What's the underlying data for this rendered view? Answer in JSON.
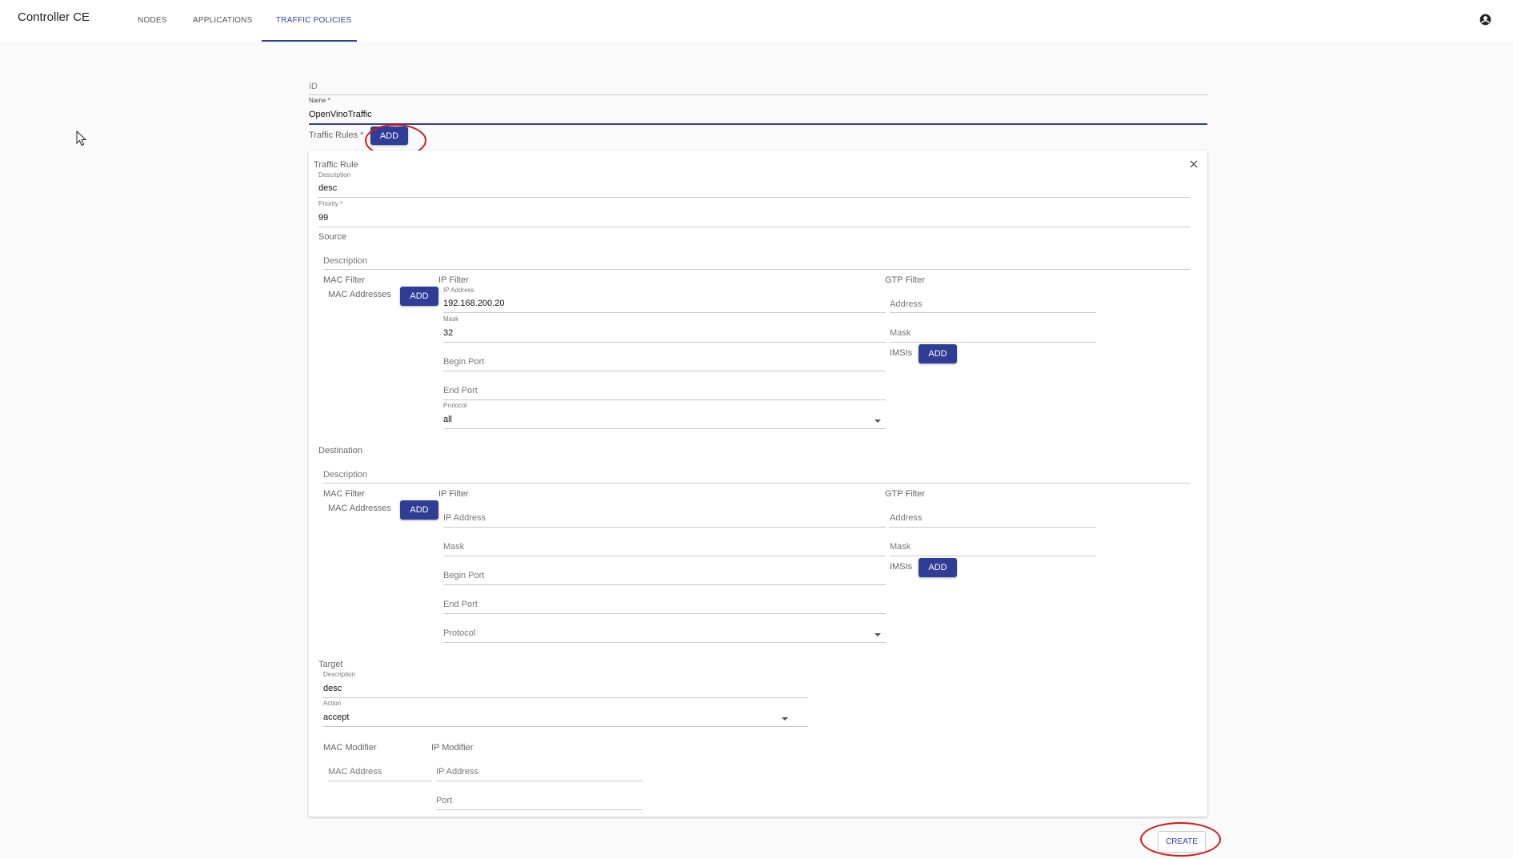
{
  "app": {
    "title": "Controller CE"
  },
  "nav": {
    "tabs": [
      {
        "label": "NODES"
      },
      {
        "label": "APPLICATIONS"
      },
      {
        "label": "TRAFFIC POLICIES"
      }
    ],
    "active_tab": "TRAFFIC POLICIES",
    "account_icon": "account-circle-icon"
  },
  "form": {
    "id_label": "ID",
    "id_value": "",
    "name_label": "Name *",
    "name_value": "OpenVinoTraffic",
    "traffic_rules_label": "Traffic Rules *",
    "add_label": "ADD",
    "create_label": "CREATE"
  },
  "rule": {
    "title": "Traffic Rule",
    "close_icon": "close-icon",
    "description_label": "Description",
    "description_value": "desc",
    "priority_label": "Priority *",
    "priority_value": "99"
  },
  "source": {
    "title": "Source",
    "description_placeholder": "Description",
    "mac_filter_label": "MAC Filter",
    "mac_addresses_label": "MAC Addresses",
    "add_label": "ADD",
    "ip_filter_label": "IP Filter",
    "ip_address_label": "IP Address",
    "ip_address_value": "192.168.200.20",
    "mask_label": "Mask",
    "mask_value": "32",
    "begin_port_placeholder": "Begin Port",
    "end_port_placeholder": "End Port",
    "protocol_label": "Protocol",
    "protocol_value": "all",
    "gtp_filter_label": "GTP Filter",
    "gtp_address_placeholder": "Address",
    "gtp_mask_placeholder": "Mask",
    "imsis_label": "IMSIs",
    "imsis_add_label": "ADD"
  },
  "destination": {
    "title": "Destination",
    "description_placeholder": "Description",
    "mac_filter_label": "MAC Filter",
    "mac_addresses_label": "MAC Addresses",
    "add_label": "ADD",
    "ip_filter_label": "IP Filter",
    "ip_address_placeholder": "IP Address",
    "mask_placeholder": "Mask",
    "begin_port_placeholder": "Begin Port",
    "end_port_placeholder": "End Port",
    "protocol_placeholder": "Protocol",
    "gtp_filter_label": "GTP Filter",
    "gtp_address_placeholder": "Address",
    "gtp_mask_placeholder": "Mask",
    "imsis_label": "IMSIs",
    "imsis_add_label": "ADD"
  },
  "target": {
    "title": "Target",
    "description_label": "Description",
    "description_value": "desc",
    "action_label": "Action",
    "action_value": "accept",
    "mac_modifier_label": "MAC Modifier",
    "mac_address_placeholder": "MAC Address",
    "ip_modifier_label": "IP Modifier",
    "ip_address_placeholder": "IP Address",
    "port_placeholder": "Port"
  },
  "colors": {
    "primary": "#303f9f",
    "button": "#2f3d96",
    "highlight": "#d81818"
  }
}
